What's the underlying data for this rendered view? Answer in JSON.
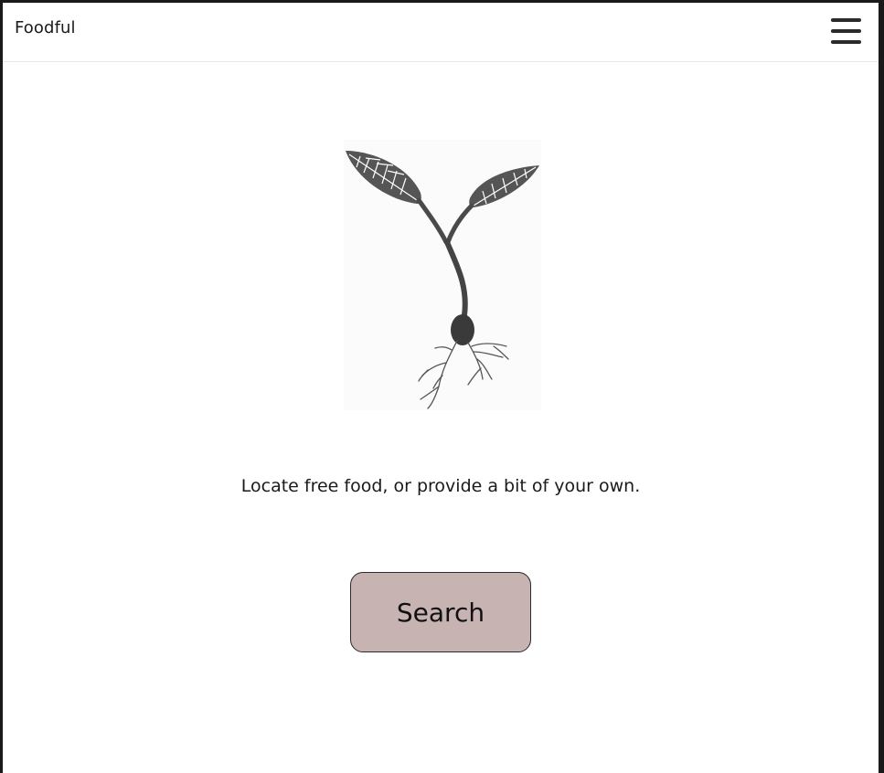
{
  "navbar": {
    "brand": "Foodful",
    "menu_icon": "hamburger-menu-icon"
  },
  "hero": {
    "image_icon": "seedling-illustration",
    "tagline": "Locate free food, or provide a bit of your own.",
    "search_label": "Search",
    "search_button_color": "#c8b3b3"
  }
}
